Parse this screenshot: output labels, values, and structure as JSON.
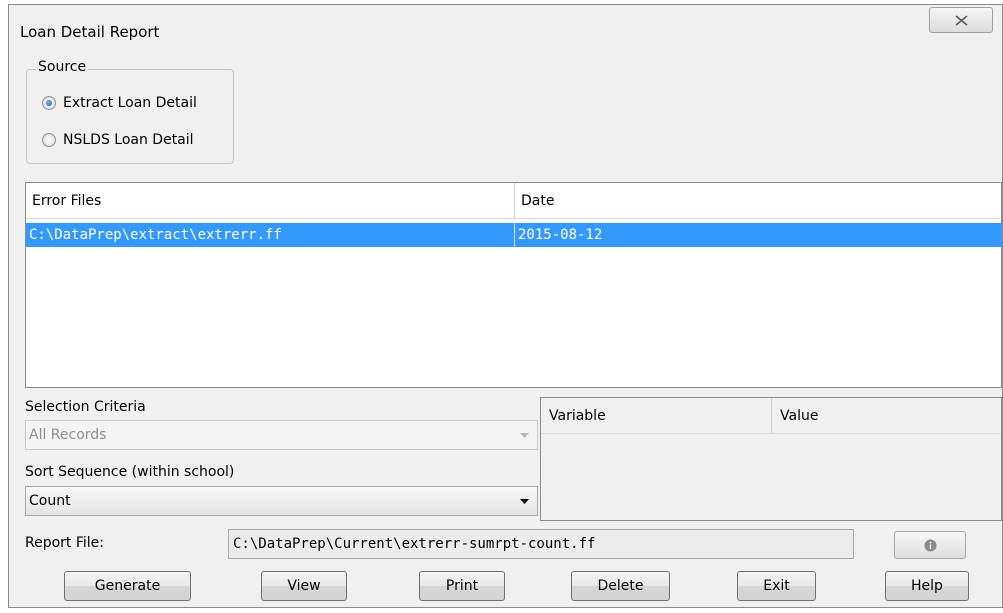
{
  "window": {
    "title": "Loan Detail Report"
  },
  "source": {
    "legend": "Source",
    "options": [
      {
        "label": "Extract Loan Detail",
        "checked": true
      },
      {
        "label": "NSLDS Loan Detail",
        "checked": false
      }
    ]
  },
  "error_files": {
    "columns": [
      "Error Files",
      "Date"
    ],
    "rows": [
      {
        "file": "C:\\DataPrep\\extract\\extrerr.ff",
        "date": "2015-08-12",
        "selected": true
      }
    ]
  },
  "selection_criteria": {
    "label": "Selection Criteria",
    "value": "All Records",
    "enabled": false
  },
  "sort_sequence": {
    "label": "Sort Sequence (within school)",
    "value": "Count"
  },
  "variables": {
    "columns": [
      "Variable",
      "Value"
    ]
  },
  "report_file": {
    "label": "Report File:",
    "value": "C:\\DataPrep\\Current\\extrerr-sumrpt-count.ff"
  },
  "buttons": {
    "generate": "Generate",
    "view": "View",
    "print": "Print",
    "delete": "Delete",
    "exit": "Exit",
    "help": "Help"
  },
  "colors": {
    "selection": "#3399ff",
    "window_bg": "#f0f0f0"
  },
  "icons": {
    "close": "close-icon",
    "info": "info-icon",
    "dropdown": "chevron-down-icon"
  }
}
